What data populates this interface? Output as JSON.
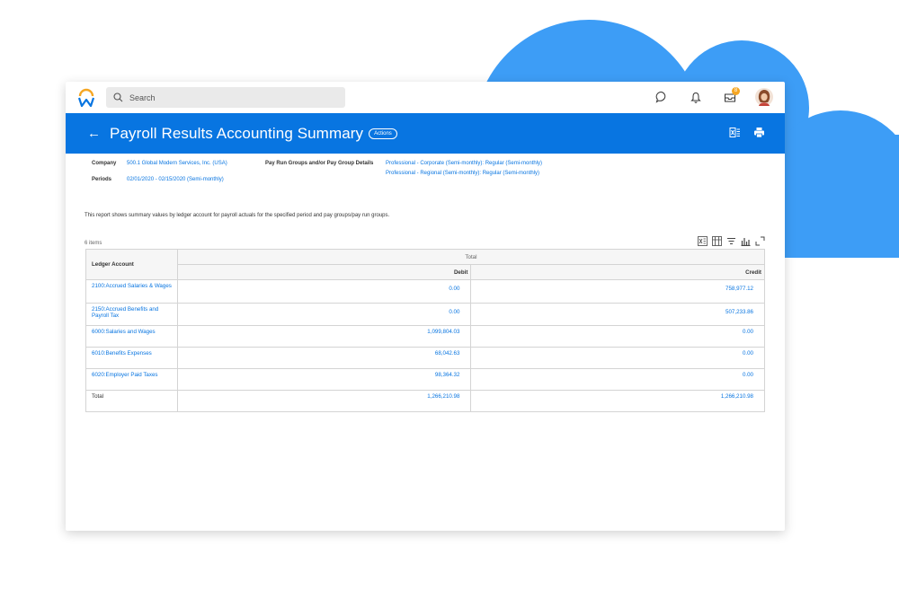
{
  "app": {
    "search_placeholder": "Search",
    "inbox_badge": "8"
  },
  "header": {
    "title": "Payroll Results Accounting Summary",
    "actions_label": "Actions"
  },
  "details": {
    "company_label": "Company",
    "company_value": "500.1 Global Modern Services, Inc. (USA)",
    "periods_label": "Periods",
    "periods_value": "02/01/2020 - 02/15/2020 (Semi-monthly)",
    "pay_run_label": "Pay Run Groups and/or Pay Group Details",
    "pay_run_values": [
      "Professional - Corporate (Semi-monthly): Regular (Semi-monthly)",
      "Professional - Regional (Semi-monthly): Regular (Semi-monthly)"
    ],
    "description": "This report shows summary values by ledger account for payroll actuals for the specified period and pay groups/pay run groups.",
    "items_count": "6 items"
  },
  "table": {
    "col_ledger": "Ledger Account",
    "col_total": "Total",
    "col_debit": "Debit",
    "col_credit": "Credit",
    "rows": [
      {
        "account": "2100:Accrued Salaries & Wages",
        "debit": "0.00",
        "credit": "758,977.12"
      },
      {
        "account": "2150:Accrued Benefits and Payroll Tax",
        "debit": "0.00",
        "credit": "507,233.86"
      },
      {
        "account": "6000:Salaries and Wages",
        "debit": "1,099,804.03",
        "credit": "0.00"
      },
      {
        "account": "6010:Benefits Expenses",
        "debit": "68,042.63",
        "credit": "0.00"
      },
      {
        "account": "6020:Employer Paid Taxes",
        "debit": "98,364.32",
        "credit": "0.00"
      }
    ],
    "total_label": "Total",
    "total_debit": "1,266,210.98",
    "total_credit": "1,266,210.98"
  },
  "colors": {
    "brand_blue": "#0875e1",
    "cloud_blue": "#3d9df6",
    "logo_orange": "#f5a623"
  },
  "icons": [
    "search-icon",
    "chat-icon",
    "bell-icon",
    "inbox-icon",
    "user-avatar",
    "back-arrow-icon",
    "excel-export-icon",
    "print-icon",
    "column-icon",
    "filter-icon",
    "chart-icon",
    "fullscreen-icon"
  ]
}
